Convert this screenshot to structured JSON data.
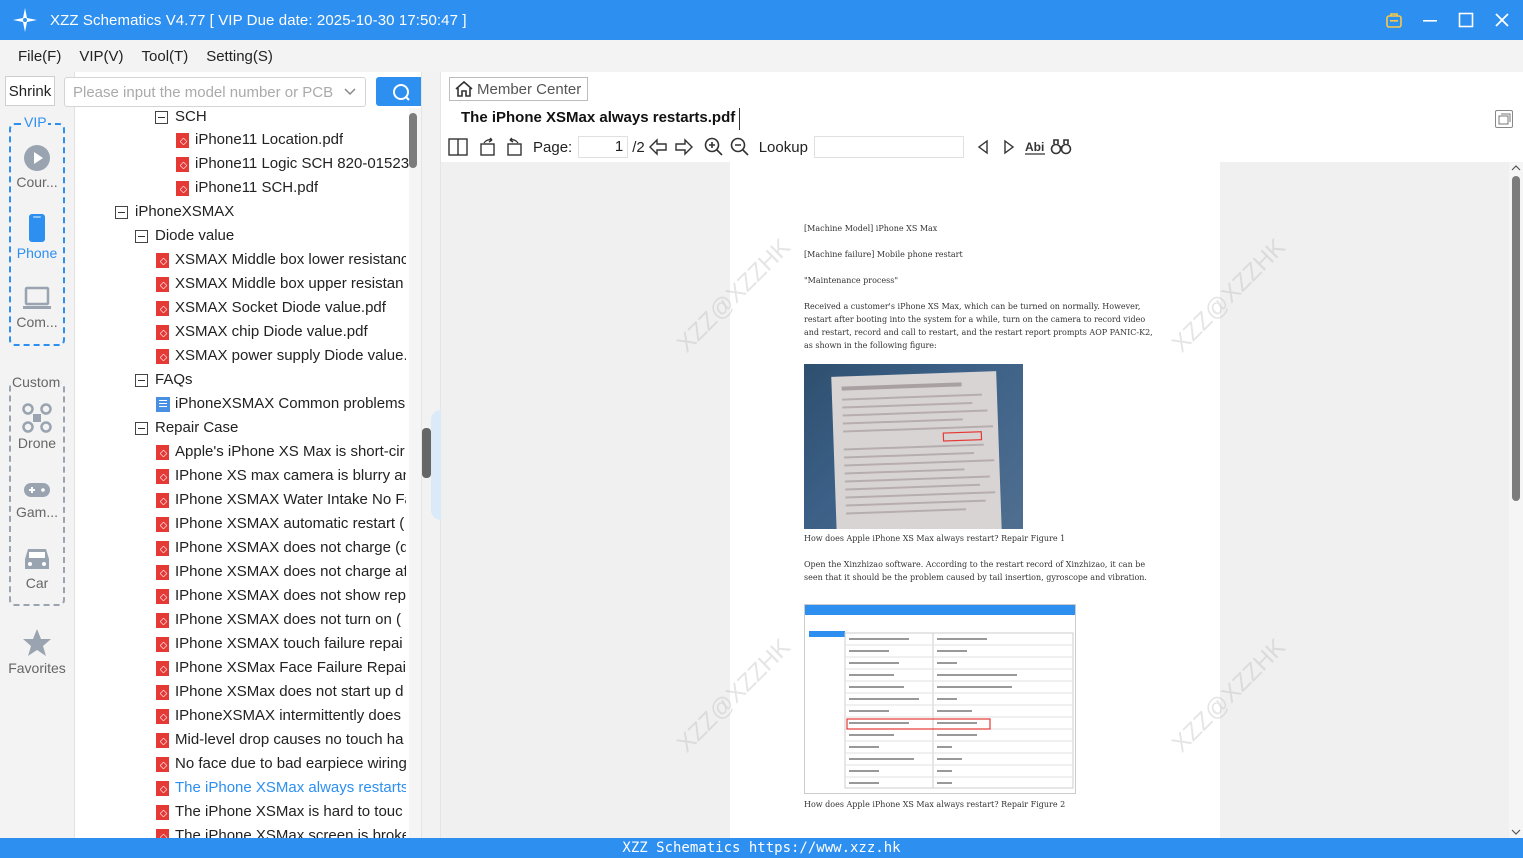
{
  "app": {
    "title": "XZZ Schematics V4.77 [ VIP Due date: 2025-10-30 17:50:47 ]"
  },
  "menu": [
    "File(F)",
    "VIP(V)",
    "Tool(T)",
    "Setting(S)"
  ],
  "sidebar": {
    "shrink_label": "Shrink",
    "search_placeholder": "Please input the model number or PCB",
    "vip_group_label": "VIP",
    "custom_group_label": "Custom",
    "items": [
      {
        "label": "Cour..."
      },
      {
        "label": "Phone"
      },
      {
        "label": "Com..."
      },
      {
        "label": "Drone"
      },
      {
        "label": "Gam..."
      },
      {
        "label": "Car"
      },
      {
        "label": "Favorites"
      }
    ]
  },
  "tree": [
    {
      "label": "SCH",
      "type": "folder"
    },
    {
      "label": "iPhone11 Location.pdf",
      "type": "pdf"
    },
    {
      "label": "iPhone11 Logic SCH 820-01523",
      "type": "pdf"
    },
    {
      "label": "iPhone11 SCH.pdf",
      "type": "pdf"
    },
    {
      "label": "iPhoneXSMAX",
      "type": "folder"
    },
    {
      "label": "Diode value",
      "type": "folder"
    },
    {
      "label": "XSMAX Middle box lower resistanc",
      "type": "pdf"
    },
    {
      "label": "XSMAX Middle box upper resistan",
      "type": "pdf"
    },
    {
      "label": "XSMAX Socket Diode value.pdf",
      "type": "pdf"
    },
    {
      "label": "XSMAX chip Diode value.pdf",
      "type": "pdf"
    },
    {
      "label": "XSMAX power supply Diode value.",
      "type": "pdf"
    },
    {
      "label": "FAQs",
      "type": "folder"
    },
    {
      "label": "iPhoneXSMAX Common problems",
      "type": "doc"
    },
    {
      "label": "Repair Case",
      "type": "folder"
    },
    {
      "label": "Apple's iPhone XS Max is short-cir",
      "type": "pdf"
    },
    {
      "label": "IPhone XS max camera is blurry an",
      "type": "pdf"
    },
    {
      "label": "IPhone XSMAX Water Intake No Fa",
      "type": "pdf"
    },
    {
      "label": "IPhone XSMAX automatic restart (",
      "type": "pdf"
    },
    {
      "label": "IPhone XSMAX does not charge (d",
      "type": "pdf"
    },
    {
      "label": "IPhone XSMAX does not charge af",
      "type": "pdf"
    },
    {
      "label": "IPhone XSMAX does not show rep",
      "type": "pdf"
    },
    {
      "label": "IPhone XSMAX does not turn on (",
      "type": "pdf"
    },
    {
      "label": "IPhone XSMAX touch failure repai",
      "type": "pdf"
    },
    {
      "label": "IPhone XSMax Face Failure Repair.",
      "type": "pdf"
    },
    {
      "label": "IPhone XSMax does not start up d",
      "type": "pdf"
    },
    {
      "label": "IPhoneXSMAX intermittently does",
      "type": "pdf"
    },
    {
      "label": "Mid-level drop causes no touch ha",
      "type": "pdf"
    },
    {
      "label": "No face due to bad earpiece wiring",
      "type": "pdf"
    },
    {
      "label": "The iPhone XSMax always restarts.",
      "type": "pdf",
      "selected": true
    },
    {
      "label": "The iPhone XSMax is hard to touc",
      "type": "pdf"
    },
    {
      "label": "The iPhone XSMax screen is broke",
      "type": "pdf"
    }
  ],
  "viewer": {
    "member_center": "Member Center",
    "doc_title": "The iPhone XSMax always restarts.pdf",
    "page_label": "Page:",
    "page_current": "1",
    "page_total": "/2",
    "lookup_label": "Lookup",
    "watermark": "XZZ@XZZHK"
  },
  "document": {
    "machine_model": "[Machine Model] iPhone XS Max",
    "machine_failure": "[Machine failure] Mobile phone restart",
    "process": "\"Maintenance process\"",
    "para1": "Received a customer's iPhone XS Max, which can be turned on normally. However, restart after booting into the system for a while, turn on the camera to record video and restart, record and call to restart, and the restart report prompts AOP PANIC-K2, as shown in the following figure:",
    "caption1": "How does Apple iPhone XS Max always restart? Repair Figure 1",
    "para2": "Open the Xinzhizao software. According to the restart record of Xinzhizao, it can be seen that it should be the problem caused by tail insertion, gyroscope and vibration.",
    "caption2": "How does Apple iPhone XS Max always restart? Repair Figure 2"
  },
  "status": {
    "text": "XZZ Schematics https://www.xzz.hk"
  },
  "colors": {
    "accent": "#2d8ff0",
    "pdf_icon": "#e53935"
  }
}
